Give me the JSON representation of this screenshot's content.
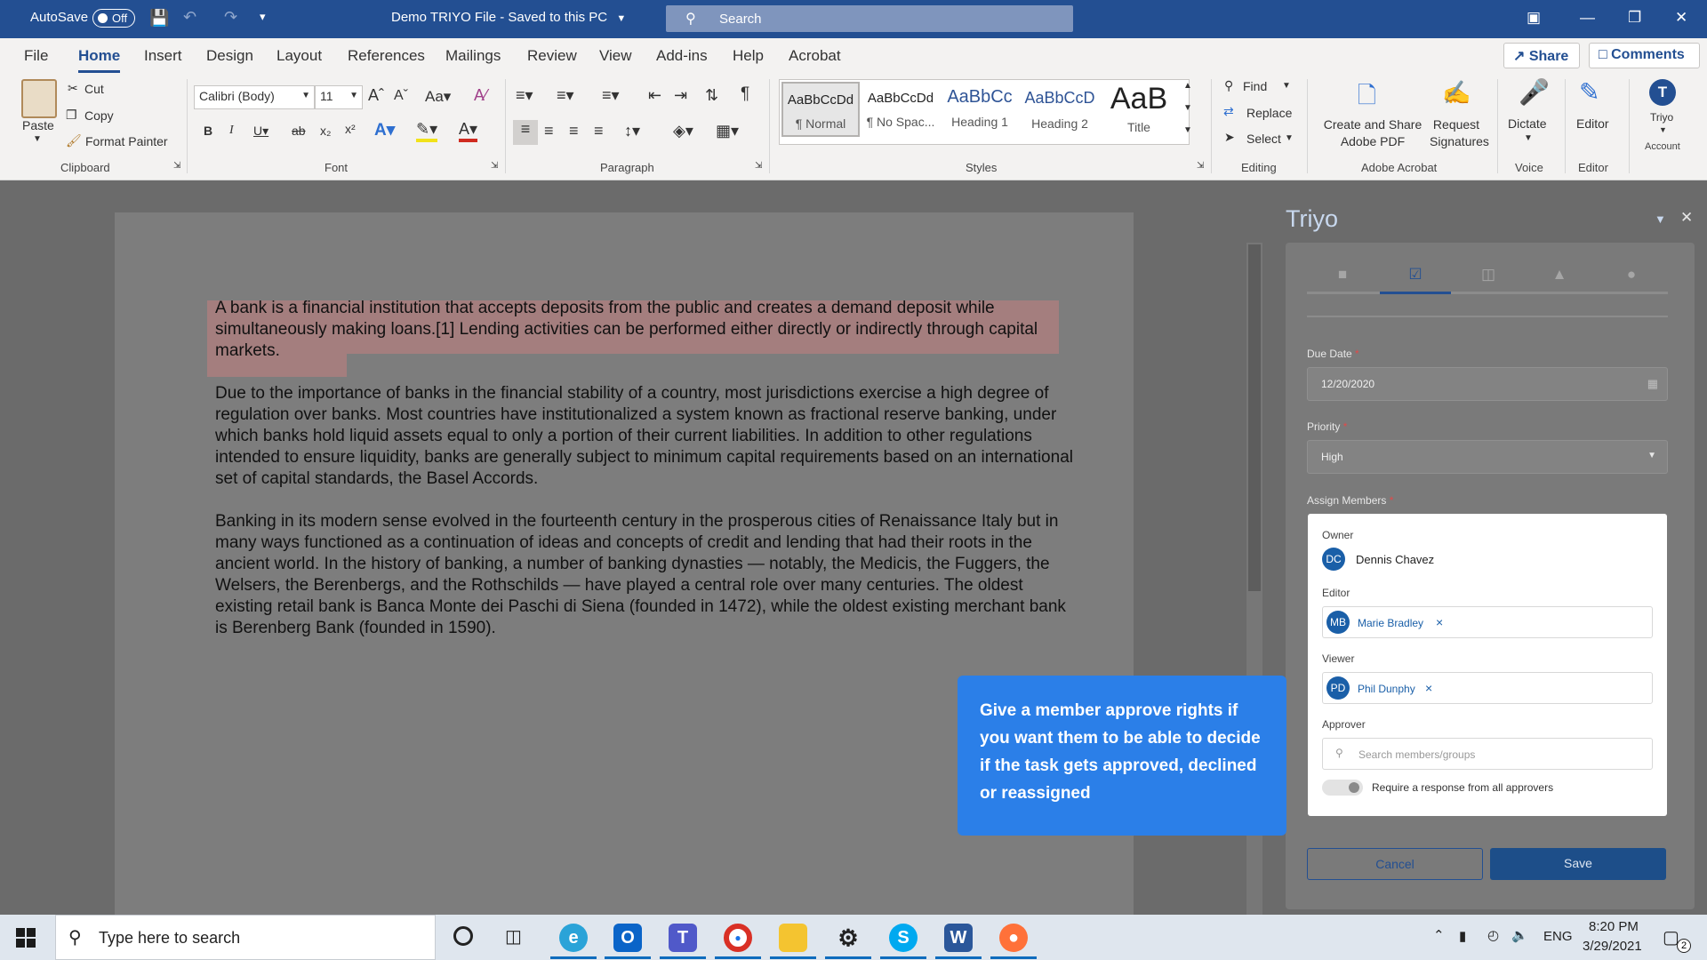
{
  "titlebar": {
    "autosave_label": "AutoSave",
    "autosave_state": "Off",
    "doc_title": "Demo TRIYO File  -  Saved to this PC",
    "search_placeholder": "Search"
  },
  "menu": {
    "tabs": [
      "File",
      "Home",
      "Insert",
      "Design",
      "Layout",
      "References",
      "Mailings",
      "Review",
      "View",
      "Add-ins",
      "Help",
      "Acrobat"
    ],
    "active_tab": "Home",
    "share": "Share",
    "comments": "Comments"
  },
  "ribbon": {
    "clipboard": {
      "paste": "Paste",
      "cut": "Cut",
      "copy": "Copy",
      "format_painter": "Format Painter",
      "group": "Clipboard"
    },
    "font": {
      "family": "Calibri (Body)",
      "size": "11",
      "group": "Font"
    },
    "paragraph": {
      "group": "Paragraph"
    },
    "styles": {
      "items": [
        {
          "sample": "AaBbCcDd",
          "label": "¶ Normal"
        },
        {
          "sample": "AaBbCcDd",
          "label": "¶ No Spac..."
        },
        {
          "sample": "AaBbCc",
          "label": "Heading 1"
        },
        {
          "sample": "AaBbCcD",
          "label": "Heading 2"
        },
        {
          "sample": "AaB",
          "label": "Title"
        }
      ],
      "group": "Styles"
    },
    "editing": {
      "find": "Find",
      "replace": "Replace",
      "select": "Select",
      "group": "Editing"
    },
    "acrobat": {
      "create_share_1": "Create and Share",
      "create_share_2": "Adobe PDF",
      "request_1": "Request",
      "request_2": "Signatures",
      "group": "Adobe Acrobat"
    },
    "voice": {
      "dictate": "Dictate",
      "group": "Voice"
    },
    "editor": {
      "editor": "Editor",
      "group": "Editor"
    },
    "triyo": {
      "label": "Triyo",
      "group": "Account"
    }
  },
  "document": {
    "paragraphs": [
      "A bank is a financial institution that accepts deposits from the public and creates a demand deposit while simultaneously making loans.[1] Lending activities can be performed either directly or indirectly through capital markets.",
      "Due to the importance of banks in the financial stability of a country, most jurisdictions exercise a high degree of regulation over banks. Most countries have institutionalized a system known as fractional reserve banking, under which banks hold liquid assets equal to only a portion of their current liabilities. In addition to other regulations intended to ensure liquidity, banks are generally subject to minimum capital requirements based on an international set of capital standards, the Basel Accords.",
      "Banking in its modern sense evolved in the fourteenth century in the prosperous cities of Renaissance Italy but in many ways functioned as a continuation of ideas and concepts of credit and lending that had their roots in the ancient world. In the history of banking, a number of banking dynasties — notably, the Medicis, the Fuggers, the Welsers, the Berenbergs, and the Rothschilds — have played a central role over many centuries. The oldest existing retail bank is Banca Monte dei Paschi di Siena (founded in 1472), while the oldest existing merchant bank is Berenberg Bank (founded in 1590)."
    ]
  },
  "pane": {
    "title": "Triyo",
    "due_date_label": "Due Date",
    "due_date_value": "12/20/2020",
    "priority_label": "Priority",
    "priority_value": "High",
    "assign_label": "Assign Members",
    "owner_label": "Owner",
    "owner": {
      "initials": "DC",
      "name": "Dennis Chavez"
    },
    "editor_label": "Editor",
    "editor": {
      "initials": "MB",
      "name": "Marie Bradley"
    },
    "viewer_label": "Viewer",
    "viewer": {
      "initials": "PD",
      "name": "Phil Dunphy"
    },
    "approver_label": "Approver",
    "approver_placeholder": "Search members/groups",
    "require_all": "Require a response from all approvers",
    "cancel": "Cancel",
    "save": "Save",
    "required_mark": "*"
  },
  "tooltip": {
    "text": "Give a member approve rights if you want them to be able to decide if the task gets approved, declined or reassigned"
  },
  "taskbar": {
    "search_placeholder": "Type here to search",
    "lang": "ENG",
    "time": "8:20 PM",
    "date": "3/29/2021",
    "notif_count": "2"
  }
}
